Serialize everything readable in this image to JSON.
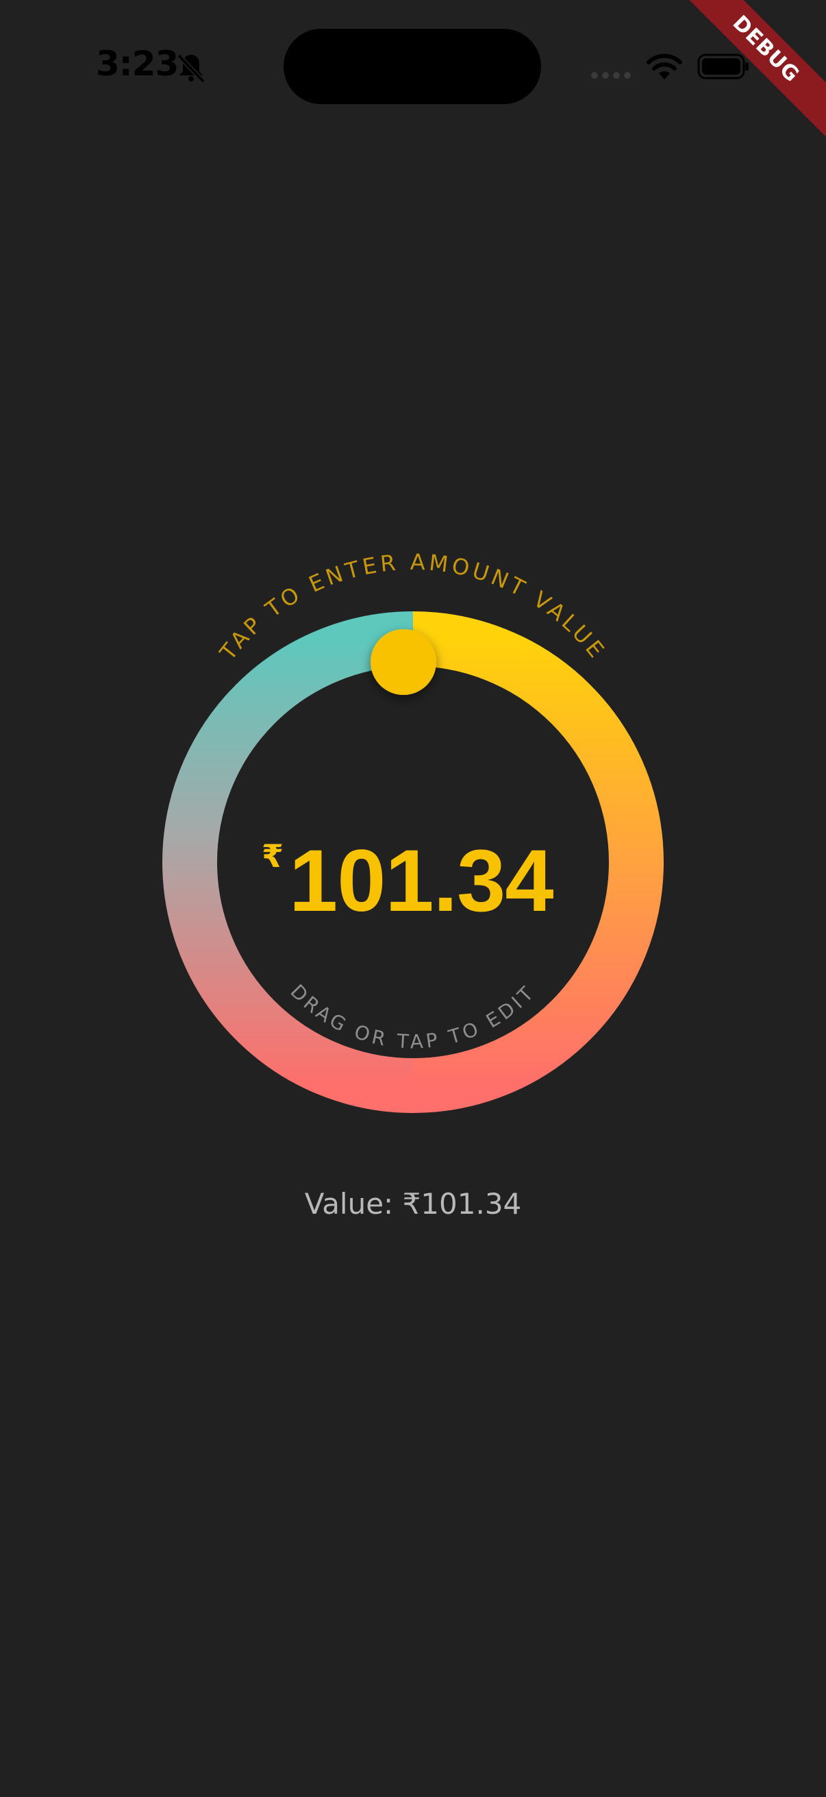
{
  "status_bar": {
    "time": "3:23",
    "silent_icon": "bell-slash-icon",
    "signal_icon": "cellular-signal-icon",
    "wifi_icon": "wifi-icon",
    "battery_icon": "battery-icon"
  },
  "debug_banner": {
    "label": "DEBUG"
  },
  "dial": {
    "top_hint": "TAP TO ENTER AMOUNT VALUE",
    "bottom_hint": "DRAG OR TAP TO EDIT",
    "currency_symbol": "₹",
    "amount": "101.34",
    "colors": {
      "teal": "#5ec8bd",
      "gray": "#a8a8a8",
      "pink": "#ff6f6b",
      "orange": "#ff9d45",
      "yellow": "#ffd20a",
      "knob": "#f8c200",
      "top_hint": "#c7970c",
      "bottom_hint": "#8e8e8e"
    }
  },
  "value_readout": {
    "label": "Value:",
    "value": "₹101.34"
  }
}
